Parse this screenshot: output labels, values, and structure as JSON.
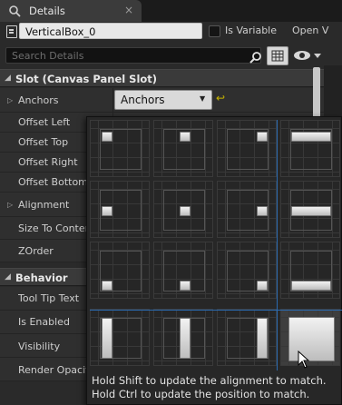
{
  "tab": {
    "title": "Details",
    "close": "×"
  },
  "header": {
    "name_value": "VerticalBox_0",
    "is_variable_label": "Is Variable",
    "open_label": "Open V"
  },
  "search": {
    "placeholder": "Search Details"
  },
  "sections": {
    "slot": {
      "title": "Slot (Canvas Panel Slot)"
    },
    "behavior": {
      "title": "Behavior"
    }
  },
  "slot_props": {
    "anchors": "Anchors",
    "offset_left": "Offset Left",
    "offset_top": "Offset Top",
    "offset_right": "Offset Right",
    "offset_bottom": "Offset Bottom",
    "alignment": "Alignment",
    "size_to_content": "Size To Conten",
    "zorder": "ZOrder"
  },
  "behavior_props": {
    "tooltip": "Tool Tip Text",
    "is_enabled": "Is Enabled",
    "visibility": "Visibility",
    "render_opacity": "Render Opacity"
  },
  "anchors_combo": {
    "value": "Anchors"
  },
  "popup": {
    "hint_shift": "Hold Shift to update the alignment to match.",
    "hint_ctrl": "Hold Ctrl to update the position to match."
  },
  "colors": {
    "panel_bg": "#2a2a2a",
    "category_bg": "#3a3a3a",
    "guide_blue": "#2a6ab0",
    "reset_yellow": "#c8b400"
  }
}
